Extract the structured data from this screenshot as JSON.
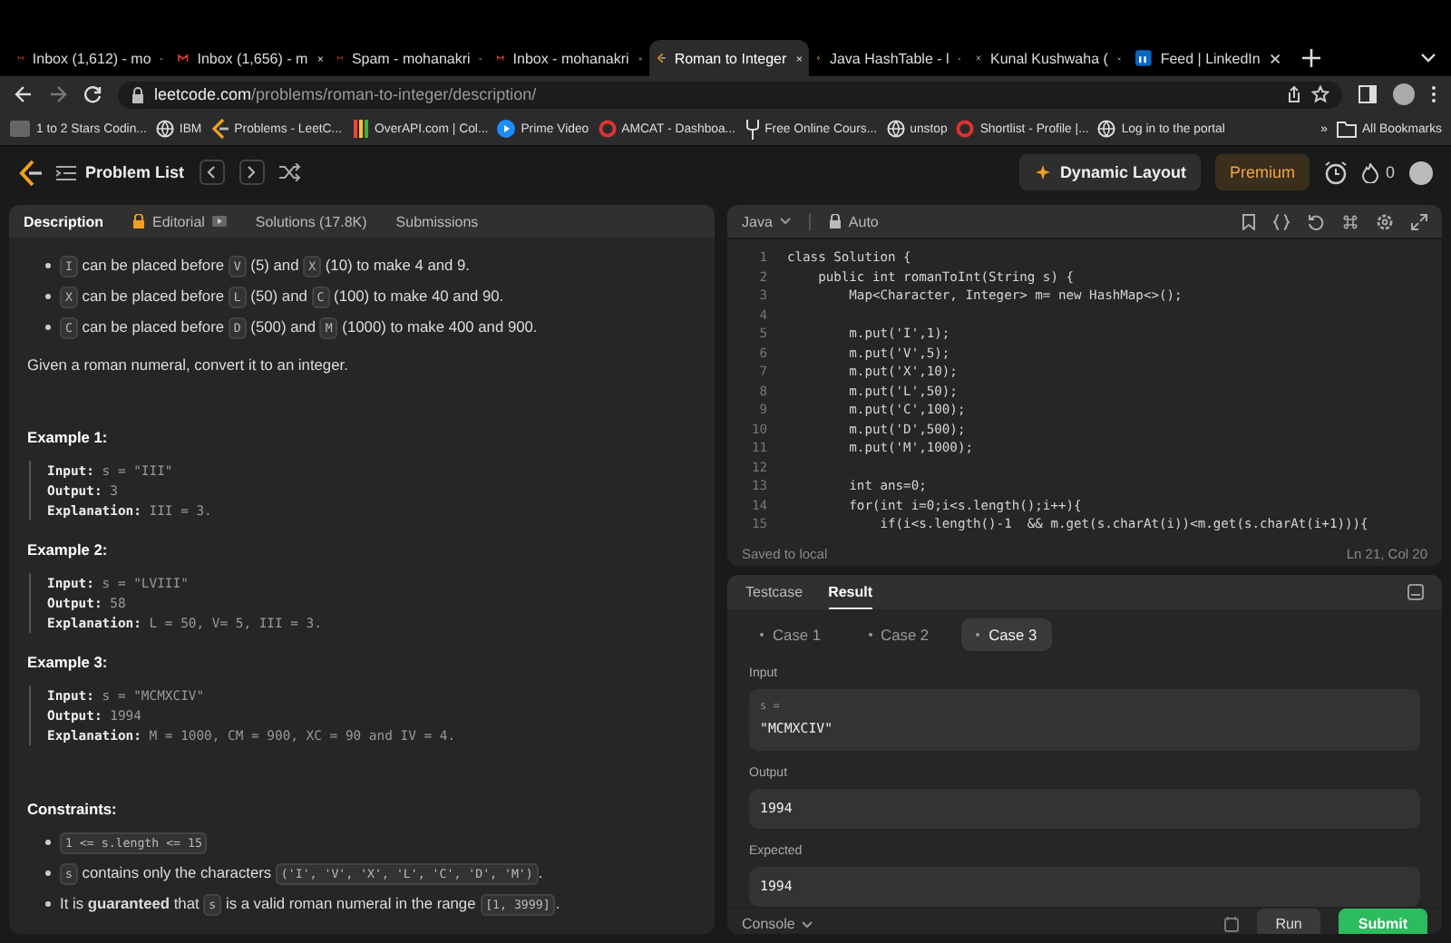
{
  "browser": {
    "tabs": [
      {
        "title": "Inbox (1,612) - mo",
        "kind": "mail",
        "selected": false
      },
      {
        "title": "Inbox (1,656) - m",
        "kind": "mail",
        "selected": false
      },
      {
        "title": "Spam - mohanakri",
        "kind": "mail",
        "selected": false
      },
      {
        "title": "Inbox - mohanakri",
        "kind": "mail",
        "selected": false
      },
      {
        "title": "Roman to Integer",
        "kind": "logo",
        "selected": true
      },
      {
        "title": "Java HashTable - l",
        "kind": "logo",
        "selected": false
      },
      {
        "title": "Kunal Kushwaha (",
        "kind": "cross",
        "selected": false
      },
      {
        "title": "Feed | LinkedIn",
        "kind": "square",
        "selected": false
      }
    ],
    "url_host": "leetcode.com",
    "url_path": "/problems/roman-to-integer/description/",
    "bookmarks": [
      {
        "label": "1 to 2 Stars Codin...",
        "kind": "badge"
      },
      {
        "label": "IBM",
        "kind": "globe"
      },
      {
        "label": "Problems - LeetC...",
        "kind": "logo"
      },
      {
        "label": "OverAPI.com | Col...",
        "kind": "bars"
      },
      {
        "label": "Prime Video",
        "kind": "play"
      },
      {
        "label": "AMCAT - Dashboa...",
        "kind": "ring"
      },
      {
        "label": "Free Online Cours...",
        "kind": "fork"
      },
      {
        "label": "unstop",
        "kind": "globe"
      },
      {
        "label": "Shortlist - Profile |...",
        "kind": "ring"
      },
      {
        "label": "Log in to the portal",
        "kind": "globe"
      }
    ],
    "more": "»",
    "all_bookmarks": "All Bookmarks"
  },
  "header": {
    "problem_list": "Problem List",
    "dynamic_layout": "Dynamic Layout",
    "premium": "Premium",
    "streak": "0"
  },
  "description": {
    "tabs": [
      {
        "label": "Description",
        "selected": true
      },
      {
        "label": "Editorial",
        "selected": false
      },
      {
        "label": "Solutions (17.8K)",
        "selected": false
      },
      {
        "label": "Submissions",
        "selected": false
      }
    ],
    "bullets": [
      [
        {
          "kind": "code",
          "text": "I"
        },
        {
          "kind": "text",
          "text": " can be placed before "
        },
        {
          "kind": "code",
          "text": "V"
        },
        {
          "kind": "text",
          "text": " (5) and "
        },
        {
          "kind": "code",
          "text": "X"
        },
        {
          "kind": "text",
          "text": " (10) to make 4 and 9."
        }
      ],
      [
        {
          "kind": "code",
          "text": "X"
        },
        {
          "kind": "text",
          "text": " can be placed before "
        },
        {
          "kind": "code",
          "text": "L"
        },
        {
          "kind": "text",
          "text": " (50) and "
        },
        {
          "kind": "code",
          "text": "C"
        },
        {
          "kind": "text",
          "text": " (100) to make 40 and 90."
        }
      ],
      [
        {
          "kind": "code",
          "text": "C"
        },
        {
          "kind": "text",
          "text": " can be placed before "
        },
        {
          "kind": "code",
          "text": "D"
        },
        {
          "kind": "text",
          "text": " (500) and "
        },
        {
          "kind": "code",
          "text": "M"
        },
        {
          "kind": "text",
          "text": " (1000) to make 400 and 900."
        }
      ]
    ],
    "paragraph": "Given a roman numeral, convert it to an integer.",
    "examples": [
      {
        "title": "Example 1:",
        "lines": [
          {
            "label": "Input:",
            "value": "s = \"III\""
          },
          {
            "label": "Output:",
            "value": "3"
          },
          {
            "label": "Explanation:",
            "value": "III = 3."
          }
        ]
      },
      {
        "title": "Example 2:",
        "lines": [
          {
            "label": "Input:",
            "value": "s = \"LVIII\""
          },
          {
            "label": "Output:",
            "value": "58"
          },
          {
            "label": "Explanation:",
            "value": "L = 50, V= 5, III = 3."
          }
        ]
      },
      {
        "title": "Example 3:",
        "lines": [
          {
            "label": "Input:",
            "value": "s = \"MCMXCIV\""
          },
          {
            "label": "Output:",
            "value": "1994"
          },
          {
            "label": "Explanation:",
            "value": "M = 1000, CM = 900, XC = 90 and IV = 4."
          }
        ]
      }
    ],
    "constraints_title": "Constraints:",
    "constraints": [
      [
        {
          "kind": "code",
          "text": "1 <= s.length <= 15"
        }
      ],
      [
        {
          "kind": "code",
          "text": "s"
        },
        {
          "kind": "text",
          "text": " contains only the characters "
        },
        {
          "kind": "code",
          "text": "('I', 'V', 'X', 'L', 'C', 'D', 'M')"
        },
        {
          "kind": "text",
          "text": "."
        }
      ],
      [
        {
          "kind": "text",
          "text": "It is **guaranteed** that "
        },
        {
          "kind": "code",
          "text": "s"
        },
        {
          "kind": "text",
          "text": " is a valid roman numeral in the range "
        },
        {
          "kind": "code",
          "text": "[1, 3999]"
        },
        {
          "kind": "text",
          "text": "."
        }
      ]
    ]
  },
  "editor": {
    "language": "Java",
    "mode": "Auto",
    "lines": [
      {
        "n": "1",
        "text": "class Solution {"
      },
      {
        "n": "2",
        "text": "    public int romanToInt(String s) {"
      },
      {
        "n": "3",
        "text": "        Map<Character, Integer> m= new HashMap<>();"
      },
      {
        "n": "4"
      },
      {
        "n": "5",
        "text": "        m.put('I',1);"
      },
      {
        "n": "6",
        "text": "        m.put('V',5);"
      },
      {
        "n": "7",
        "text": "        m.put('X',10);"
      },
      {
        "n": "8",
        "text": "        m.put('L',50);"
      },
      {
        "n": "9",
        "text": "        m.put('C',100);"
      },
      {
        "n": "10",
        "text": "        m.put('D',500);"
      },
      {
        "n": "11",
        "text": "        m.put('M',1000);"
      },
      {
        "n": "12"
      },
      {
        "n": "13",
        "text": "        int ans=0;"
      },
      {
        "n": "14",
        "text": "        for(int i=0;i<s.length();i++){"
      },
      {
        "n": "15",
        "text": "            if(i<s.length()-1  && m.get(s.charAt(i))<m.get(s.charAt(i+1))){"
      }
    ],
    "status": "Saved to local",
    "position": "Ln 21, Col 20"
  },
  "result": {
    "tabs": [
      {
        "label": "Testcase",
        "selected": false
      },
      {
        "label": "Result",
        "selected": true
      }
    ],
    "cases": [
      {
        "label": "Case 1",
        "selected": false
      },
      {
        "label": "Case 2",
        "selected": false
      },
      {
        "label": "Case 3",
        "selected": true
      }
    ],
    "input_label": "Input",
    "input_var": "s =",
    "input_value": "\"MCMXCIV\"",
    "output_label": "Output",
    "output_value": "1994",
    "expected_label": "Expected",
    "expected_value": "1994",
    "console": "Console",
    "run": "Run",
    "submit": "Submit"
  }
}
